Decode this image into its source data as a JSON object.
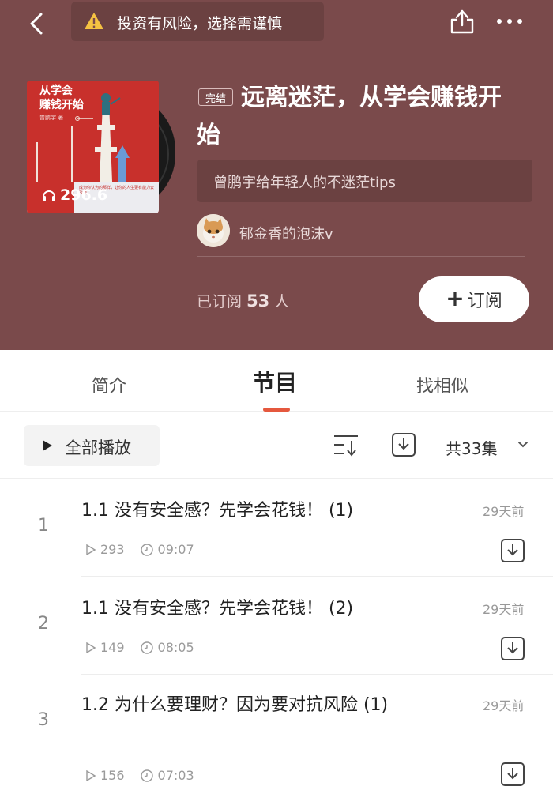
{
  "top_bar": {
    "risk_warning": "投资有风险，选择需谨慎"
  },
  "album": {
    "cover": {
      "title_line1": "从学会",
      "title_line2": "赚钱开始",
      "author": "曾鹏宇 著",
      "play_count": "296.6",
      "tiny_text": "成为你认为的那样，让你的人生更有能力去改变"
    },
    "status_tag": "完结",
    "title": "远离迷茫，从学会赚钱开始",
    "subtitle": "曾鹏宇给年轻人的不迷茫tips",
    "author_name": "郁金香的泡沫v",
    "subscribed_prefix": "已订阅",
    "subscribed_count": "53",
    "subscribed_suffix": "人",
    "subscribe_label": "订阅",
    "colors": {
      "header_bg": "#7a4a4b",
      "accent": "#e5583e"
    }
  },
  "tabs": [
    {
      "label": "简介"
    },
    {
      "label": "节目",
      "active": true
    },
    {
      "label": "找相似"
    }
  ],
  "toolbar": {
    "play_all_label": "全部播放",
    "episode_total": "共33集"
  },
  "episodes": [
    {
      "index": "1",
      "title": "1.1 没有安全感？先学会花钱！ (1)",
      "date": "29天前",
      "plays": "293",
      "duration": "09:07"
    },
    {
      "index": "2",
      "title": "1.1 没有安全感？先学会花钱！ (2)",
      "date": "29天前",
      "plays": "149",
      "duration": "08:05"
    },
    {
      "index": "3",
      "title": "1.2 为什么要理财？因为要对抗风险 (1)",
      "date": "29天前",
      "plays": "156",
      "duration": "07:03"
    }
  ],
  "icons": [
    "back-arrow-icon",
    "warning-icon",
    "share-icon",
    "more-icon",
    "headphones-icon",
    "play-icon",
    "sort-icon",
    "download-icon",
    "chevron-down-icon",
    "clock-icon"
  ]
}
